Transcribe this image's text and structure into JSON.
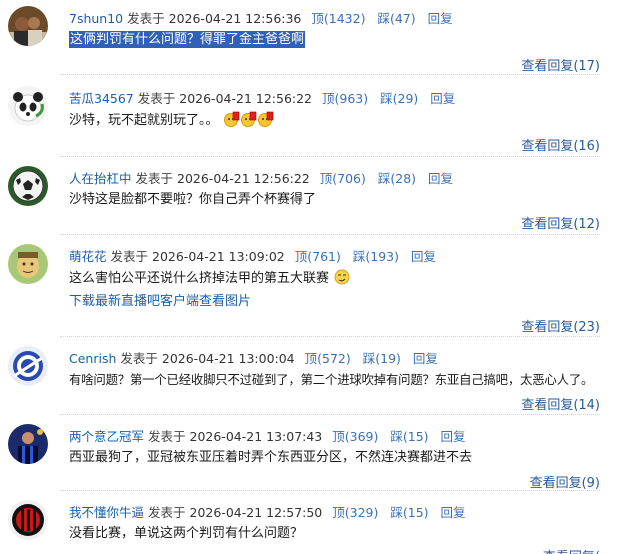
{
  "labels": {
    "ding": "顶",
    "cai": "踩",
    "reply": "回复",
    "posted": "发表于",
    "view_replies": "查看回复"
  },
  "comments": [
    {
      "user": "7shun10",
      "time": "2026-04-21 12:56:36",
      "ding": "顶(1432)",
      "cai": "踩(47)",
      "text": "这俩判罚有什么问题？得罪了金主爸爸啊",
      "replies": "查看回复(17)",
      "avatar": "person-photo"
    },
    {
      "user": "苦瓜34567",
      "time": "2026-04-21 12:56:22",
      "ding": "顶(963)",
      "cai": "踩(29)",
      "text": "沙特，玩不起就别玩了。。",
      "emoji": [
        "red-card-emoji",
        "red-card-emoji",
        "red-card-emoji"
      ],
      "replies": "查看回复(16)",
      "avatar": "panda"
    },
    {
      "user": "人在抬杠中",
      "time": "2026-04-21 12:56:22",
      "ding": "顶(706)",
      "cai": "踩(28)",
      "text": "沙特这是脸都不要啦？你自己弄个杯赛得了",
      "replies": "查看回复(12)",
      "avatar": "soccer-ball"
    },
    {
      "user": "萌花花",
      "time": "2026-04-21 13:09:02",
      "ding": "顶(761)",
      "cai": "踩(193)",
      "text": "这么害怕公平还说什么挤掉法甲的第五大联赛",
      "emoji": [
        "smirk-emoji"
      ],
      "link": "下载最新直播吧客户端查看图片",
      "replies": "查看回复(23)",
      "avatar": "cartoon"
    },
    {
      "user": "Cenrish",
      "time": "2026-04-21 13:00:04",
      "ding": "顶(572)",
      "cai": "踩(19)",
      "text": "有啥问题？第一个已经收脚只不过碰到了，第二个进球吹掉有问题？东亚自己搞吧，太恶心人了。",
      "replies": "查看回复(14)",
      "avatar": "club-badge"
    },
    {
      "user": "两个意乙冠军",
      "time": "2026-04-21 13:07:43",
      "ding": "顶(369)",
      "cai": "踩(15)",
      "text": "西亚最狗了，亚冠被东亚压着时弄个东西亚分区，不然连决赛都进不去",
      "replies": "查看回复(9)",
      "avatar": "inter-player"
    },
    {
      "user": "我不懂你牛逼",
      "time": "2026-04-21 12:57:50",
      "ding": "顶(329)",
      "cai": "踩(15)",
      "text": "没看比赛，单说这两个判罚有什么问题？",
      "replies": "查看回复(",
      "avatar": "milan-badge"
    }
  ]
}
